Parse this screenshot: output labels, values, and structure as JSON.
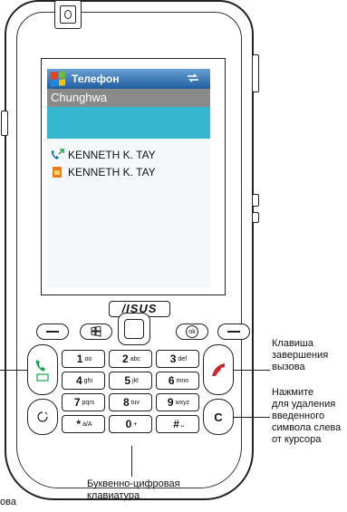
{
  "screen": {
    "title": "Телефон",
    "carrier": "Chunghwa",
    "entries": [
      "KENNETH K. TAY",
      "KENNETH K. TAY"
    ]
  },
  "brand": "/ISUS",
  "keypad": [
    {
      "num": "1",
      "letters": "oo"
    },
    {
      "num": "2",
      "letters": "abc"
    },
    {
      "num": "3",
      "letters": "def"
    },
    {
      "num": "4",
      "letters": "ghi"
    },
    {
      "num": "5",
      "letters": "jkl"
    },
    {
      "num": "6",
      "letters": "mno"
    },
    {
      "num": "7",
      "letters": "pqrs"
    },
    {
      "num": "8",
      "letters": "tuv"
    },
    {
      "num": "9",
      "letters": "wxyz"
    },
    {
      "num": "*",
      "letters": "a/A"
    },
    {
      "num": "0",
      "letters": "+"
    },
    {
      "num": "#",
      "letters": "⎵"
    }
  ],
  "keys": {
    "ok": "ok",
    "clear": "C"
  },
  "callouts": {
    "end_key": "Клавиша\nзавершения\nвызова",
    "clear_key": "Нажмите\nдля удаления\nвведенного\nсимвола слева\nот курсора",
    "alpha_keypad": "Буквенно-цифровая\nклавиатура",
    "left_cut": "ова"
  },
  "colors": {
    "titlebar": "#1f5e9f",
    "carrier": "#8a8a8a",
    "band": "#36b7cf",
    "call_green": "#1aa34a",
    "end_red": "#d2232a"
  }
}
